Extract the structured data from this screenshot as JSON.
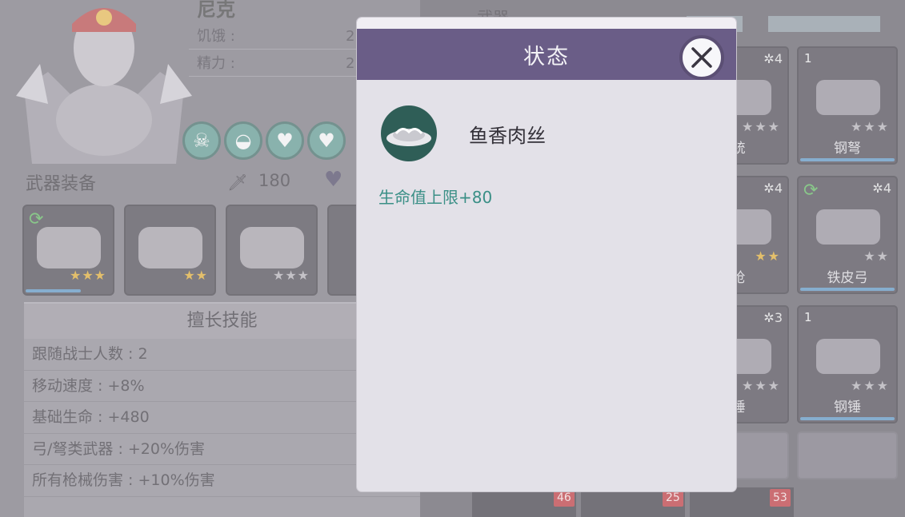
{
  "hero": {
    "name": "尼克",
    "stats": [
      {
        "label": "饥饿 :",
        "value": "2"
      },
      {
        "label": "精力 :",
        "value": "2"
      }
    ],
    "buff_icons": [
      "skull-buff-icon",
      "dish-buff-icon",
      "heart-buff-icon",
      "heart-buff-icon"
    ]
  },
  "equipment": {
    "title": "武器装备",
    "attack": "180",
    "slots": [
      {
        "art": "spiked-mace",
        "stars_gold": "★★★",
        "stars_grey": "",
        "refresh": true,
        "bar": true
      },
      {
        "art": "shoulder-pad",
        "stars_gold": "★★",
        "stars_grey": "",
        "refresh": false,
        "bar": false
      },
      {
        "art": "spiked-armor",
        "stars_gold": "",
        "stars_grey": "★★★",
        "refresh": false,
        "bar": false
      },
      {
        "art": "partial",
        "stars_gold": "",
        "stars_grey": "",
        "refresh": false,
        "bar": false
      }
    ]
  },
  "skills": {
    "title": "擅长技能",
    "items": [
      "跟随战士人数 : 2",
      "移动速度 : +8%",
      "基础生命 : +480",
      "弓/弩类武器 : +20%伤害",
      "所有枪械伤害 : +10%伤害"
    ]
  },
  "inventory": {
    "title": "武器",
    "items": [
      {
        "num": "",
        "gear": "✲4",
        "stars": "★★★",
        "name": "铳",
        "gold": false
      },
      {
        "num": "1",
        "gear": "",
        "stars": "★★★",
        "name": "钢弩",
        "gold": false
      },
      {
        "num": "",
        "gear": "✲4",
        "stars": "★★",
        "name": "枪",
        "gold": true
      },
      {
        "num": "",
        "gear": "✲4",
        "stars": "★★",
        "name": "铁皮弓",
        "gold": false
      },
      {
        "num": "",
        "gear": "✲3",
        "stars": "★★★",
        "name": "锤",
        "gold": false
      },
      {
        "num": "1",
        "gear": "",
        "stars": "★★★",
        "name": "钢锤",
        "gold": false
      }
    ],
    "counts": [
      "46",
      "25",
      "53"
    ]
  },
  "dialog": {
    "title": "状态",
    "food_name": "鱼香肉丝",
    "effect": "生命值上限+80"
  },
  "colors": {
    "header": "#6a5d87",
    "effect_text": "#3a8f86",
    "buff_teal": "#4f8e84"
  }
}
